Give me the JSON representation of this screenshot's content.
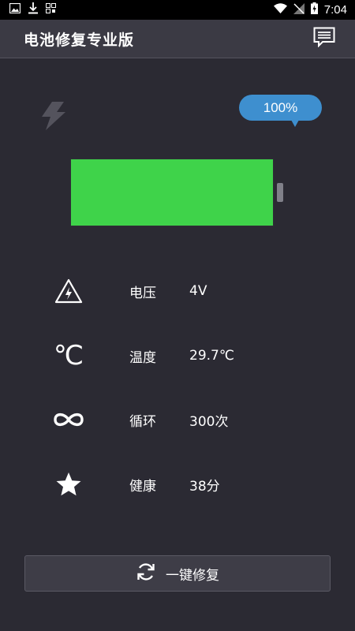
{
  "status_bar": {
    "time": "7:04",
    "icons": [
      "image-icon",
      "download-icon",
      "qr-icon",
      "wifi-icon",
      "no-sim-icon",
      "battery-charging-icon"
    ]
  },
  "app_bar": {
    "title": "电池修复专业版",
    "message_icon": "chat-message-icon"
  },
  "battery": {
    "level_text": "100%",
    "level_fraction": 1.0,
    "fill_color": "#3fd34a",
    "charging_icon": "lightning-bolt-icon"
  },
  "stats": [
    {
      "icon": "voltage-warning-icon",
      "label": "电压",
      "value": "4V"
    },
    {
      "icon": "celsius-icon",
      "icon_text": "℃",
      "label": "温度",
      "value": "29.7℃"
    },
    {
      "icon": "infinity-icon",
      "label": "循环",
      "value": "300次"
    },
    {
      "icon": "star-icon",
      "label": "健康",
      "value": "38分"
    }
  ],
  "repair_button": {
    "label": "一键修复",
    "icon": "refresh-icon"
  },
  "colors": {
    "background": "#2b2a33",
    "app_bar": "#3b3a44",
    "accent_bubble": "#3e8fcf",
    "battery_green": "#3fd34a"
  }
}
